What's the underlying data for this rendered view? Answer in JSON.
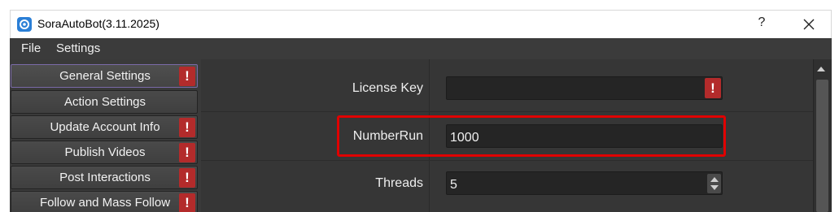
{
  "window": {
    "title": "SoraAutoBot(3.11.2025)",
    "help_label": "?",
    "app_icon": "app-logo-icon",
    "close_icon": "close-icon"
  },
  "menu": {
    "items": [
      {
        "label": "File"
      },
      {
        "label": "Settings"
      }
    ]
  },
  "sidebar": {
    "items": [
      {
        "label": "General Settings",
        "warning": "!",
        "active": true
      },
      {
        "label": "Action Settings",
        "warning": "",
        "active": false
      },
      {
        "label": "Update Account Info",
        "warning": "!",
        "active": false
      },
      {
        "label": "Publish Videos",
        "warning": "!",
        "active": false
      },
      {
        "label": "Post Interactions",
        "warning": "!",
        "active": false
      },
      {
        "label": "Follow and Mass Follow",
        "warning": "!",
        "active": false
      }
    ]
  },
  "form": {
    "license_key": {
      "label": "License Key",
      "value": "",
      "warning": "!"
    },
    "number_run": {
      "label": "NumberRun",
      "value": "1000"
    },
    "threads": {
      "label": "Threads",
      "value": "5"
    }
  },
  "colors": {
    "warning": "#b32b2b",
    "highlight": "#e00000",
    "active_border": "#7a6aa8"
  }
}
